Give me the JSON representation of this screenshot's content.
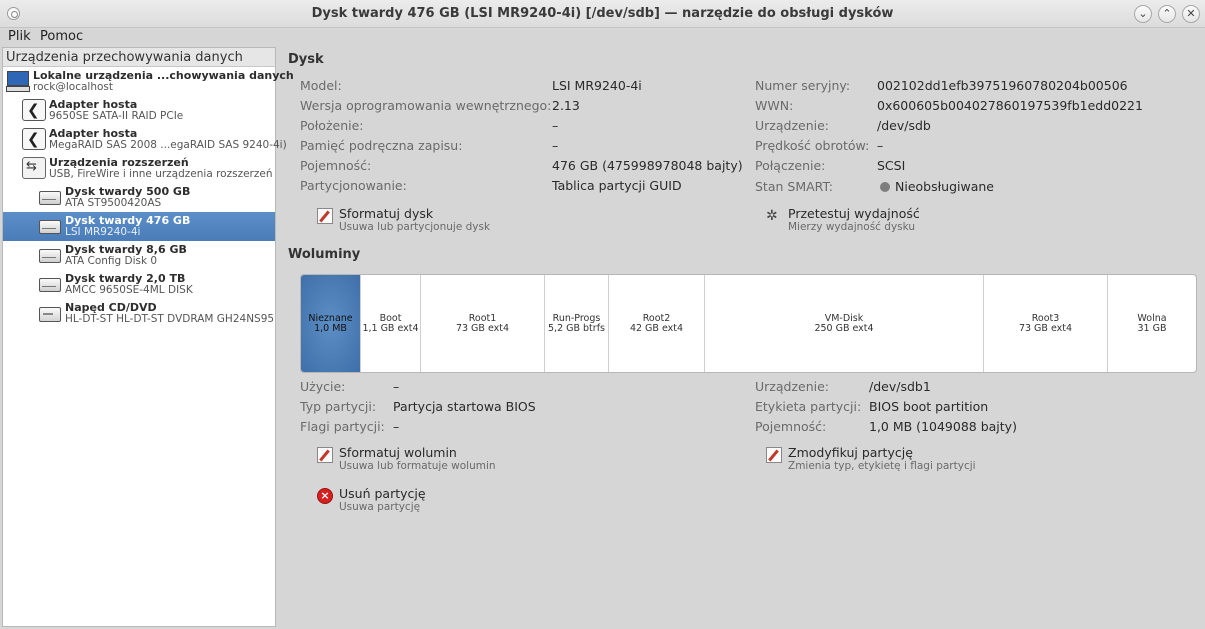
{
  "window": {
    "title": "Dysk twardy 476 GB (LSI MR9240-4i) [/dev/sdb] — narzędzie do obsługi dysków",
    "buttons": {
      "minimize": "⌄",
      "maximize": "⌃",
      "close": "✕"
    }
  },
  "menu": {
    "file": "Plik",
    "help": "Pomoc"
  },
  "sidebar": {
    "header": "Urządzenia przechowywania danych",
    "items": [
      {
        "title": "Lokalne urządzenia ...chowywania danych",
        "sub": "rock@localhost",
        "icon": "computer-icon"
      },
      {
        "title": "Adapter hosta",
        "sub": "9650SE SATA-II RAID PCIe",
        "icon": "host-adapter-icon"
      },
      {
        "title": "Adapter hosta",
        "sub": "MegaRAID SAS 2008 ...egaRAID SAS 9240-4i)",
        "icon": "host-adapter-icon"
      },
      {
        "title": "Urządzenia rozszerzeń",
        "sub": "USB, FireWire i inne urządzenia rozszerzeń",
        "icon": "usb-icon"
      },
      {
        "title": "Dysk twardy 500 GB",
        "sub": "ATA ST9500420AS",
        "icon": "hard-disk-icon"
      },
      {
        "title": "Dysk twardy 476 GB",
        "sub": "LSI MR9240-4i",
        "icon": "hard-disk-icon"
      },
      {
        "title": "Dysk twardy 8,6 GB",
        "sub": "ATA Config   Disk 0",
        "icon": "hard-disk-icon"
      },
      {
        "title": "Dysk twardy 2,0 TB",
        "sub": "AMCC 9650SE-4ML DISK",
        "icon": "hard-disk-icon"
      },
      {
        "title": "Napęd CD/DVD",
        "sub": "HL-DT-ST HL-DT-ST DVDRAM GH24NS95",
        "icon": "optical-drive-icon"
      }
    ],
    "selected_index": 5
  },
  "disk": {
    "section_title": "Dysk",
    "left": [
      {
        "label": "Model:",
        "value": "LSI MR9240-4i"
      },
      {
        "label": "Wersja oprogramowania wewnętrznego:",
        "value": "2.13"
      },
      {
        "label": "Położenie:",
        "value": "–"
      },
      {
        "label": "Pamięć podręczna zapisu:",
        "value": "–"
      },
      {
        "label": "Pojemność:",
        "value": "476 GB (475998978048 bajty)"
      },
      {
        "label": "Partycjonowanie:",
        "value": "Tablica partycji GUID"
      }
    ],
    "right": [
      {
        "label": "Numer seryjny:",
        "value": "002102dd1efb39751960780204b00506"
      },
      {
        "label": "WWN:",
        "value": "0x600605b004027860197539fb1edd0221"
      },
      {
        "label": "Urządzenie:",
        "value": "/dev/sdb"
      },
      {
        "label": "Prędkość obrotów:",
        "value": "–"
      },
      {
        "label": "Połączenie:",
        "value": "SCSI"
      },
      {
        "label": "Stan SMART:",
        "value": "Nieobsługiwane"
      }
    ],
    "actions": {
      "format": {
        "title": "Sformatuj dysk",
        "sub": "Usuwa lub partycjonuje dysk"
      },
      "benchmark": {
        "title": "Przetestuj wydajność",
        "sub": "Mierzy wydajność dysku"
      }
    }
  },
  "volumes": {
    "section_title": "Woluminy",
    "segments": [
      {
        "name": "Nieznane",
        "info": "1,0 MB",
        "active": true
      },
      {
        "name": "Boot",
        "info": "1,1 GB ext4"
      },
      {
        "name": "Root1",
        "info": "73 GB ext4"
      },
      {
        "name": "Run-Progs",
        "info": "5,2 GB btrfs"
      },
      {
        "name": "Root2",
        "info": "42 GB ext4"
      },
      {
        "name": "VM-Disk",
        "info": "250 GB ext4"
      },
      {
        "name": "Root3",
        "info": "73 GB ext4"
      },
      {
        "name": "Wolna",
        "info": "31 GB"
      }
    ],
    "left": [
      {
        "label": "Użycie:",
        "value": "–"
      },
      {
        "label": "Typ partycji:",
        "value": "Partycja startowa BIOS"
      },
      {
        "label": "Flagi partycji:",
        "value": "–"
      }
    ],
    "right": [
      {
        "label": "Urządzenie:",
        "value": "/dev/sdb1"
      },
      {
        "label": "Etykieta partycji:",
        "value": "BIOS boot partition"
      },
      {
        "label": "Pojemność:",
        "value": "1,0 MB (1049088 bajty)"
      }
    ],
    "actions": {
      "format": {
        "title": "Sformatuj wolumin",
        "sub": "Usuwa lub formatuje wolumin"
      },
      "modify": {
        "title": "Zmodyfikuj partycję",
        "sub": "Zmienia typ, etykietę i flagi partycji"
      },
      "delete": {
        "title": "Usuń partycję",
        "sub": "Usuwa partycję"
      }
    }
  }
}
